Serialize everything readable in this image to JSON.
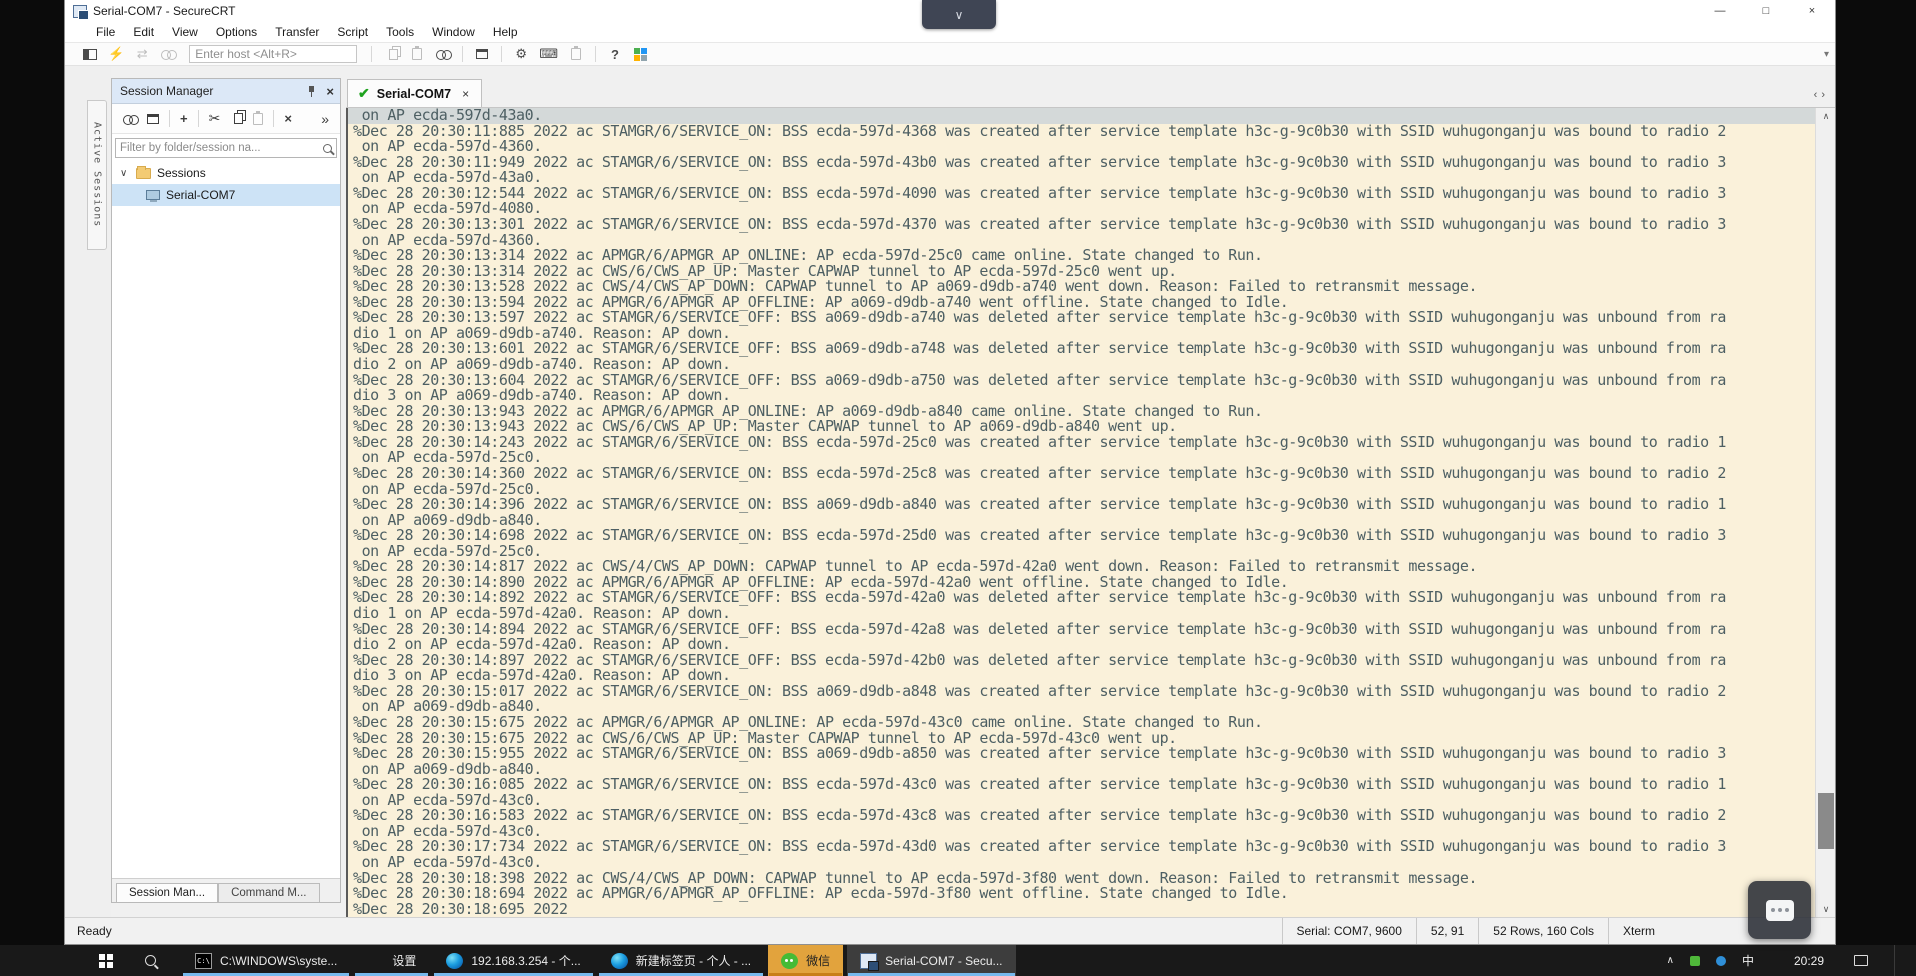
{
  "window": {
    "title": "Serial-COM7 - SecureCRT"
  },
  "icons": {
    "window_min": "—",
    "window_max": "□",
    "window_close": "×",
    "quick_connect": "⚡",
    "reconnect": "⇄",
    "help": "?",
    "gear": "⚙",
    "keypad": "⌨",
    "plus": "+",
    "scissors": "✂",
    "delete_x": "×",
    "overflow": "»",
    "tab_check": "✔",
    "tab_close": "×",
    "chev_down": "∨",
    "chev_up": "∧",
    "chev_left": "‹",
    "chev_right": "›",
    "toolbar_more": "▾",
    "tree_expander": "∨"
  },
  "menu": {
    "items": [
      "File",
      "Edit",
      "View",
      "Options",
      "Transfer",
      "Script",
      "Tools",
      "Window",
      "Help"
    ]
  },
  "toolbar": {
    "host_placeholder": "Enter host <Alt+R>"
  },
  "session_manager": {
    "title": "Session Manager",
    "side_tab": "Active Sessions",
    "filter_placeholder": "Filter by folder/session na...",
    "tree": {
      "root": "Sessions",
      "session": "Serial-COM7"
    },
    "bottom_tabs": [
      "Session Man...",
      "Command M..."
    ]
  },
  "tab": {
    "label": "Serial-COM7"
  },
  "terminal": {
    "selected_row": 0,
    "lines": [
      " on AP ecda-597d-43a0.",
      "%Dec 28 20:30:11:885 2022 ac STAMGR/6/SERVICE_ON: BSS ecda-597d-4368 was created after service template h3c-g-9c0b30 with SSID wuhugonganju was bound to radio 2",
      " on AP ecda-597d-4360.",
      "%Dec 28 20:30:11:949 2022 ac STAMGR/6/SERVICE_ON: BSS ecda-597d-43b0 was created after service template h3c-g-9c0b30 with SSID wuhugonganju was bound to radio 3",
      " on AP ecda-597d-43a0.",
      "%Dec 28 20:30:12:544 2022 ac STAMGR/6/SERVICE_ON: BSS ecda-597d-4090 was created after service template h3c-g-9c0b30 with SSID wuhugonganju was bound to radio 3",
      " on AP ecda-597d-4080.",
      "%Dec 28 20:30:13:301 2022 ac STAMGR/6/SERVICE_ON: BSS ecda-597d-4370 was created after service template h3c-g-9c0b30 with SSID wuhugonganju was bound to radio 3",
      " on AP ecda-597d-4360.",
      "%Dec 28 20:30:13:314 2022 ac APMGR/6/APMGR_AP_ONLINE: AP ecda-597d-25c0 came online. State changed to Run.",
      "%Dec 28 20:30:13:314 2022 ac CWS/6/CWS_AP_UP: Master CAPWAP tunnel to AP ecda-597d-25c0 went up.",
      "%Dec 28 20:30:13:528 2022 ac CWS/4/CWS_AP_DOWN: CAPWAP tunnel to AP a069-d9db-a740 went down. Reason: Failed to retransmit message.",
      "%Dec 28 20:30:13:594 2022 ac APMGR/6/APMGR_AP_OFFLINE: AP a069-d9db-a740 went offline. State changed to Idle.",
      "%Dec 28 20:30:13:597 2022 ac STAMGR/6/SERVICE_OFF: BSS a069-d9db-a740 was deleted after service template h3c-g-9c0b30 with SSID wuhugonganju was unbound from ra",
      "dio 1 on AP a069-d9db-a740. Reason: AP down.",
      "%Dec 28 20:30:13:601 2022 ac STAMGR/6/SERVICE_OFF: BSS a069-d9db-a748 was deleted after service template h3c-g-9c0b30 with SSID wuhugonganju was unbound from ra",
      "dio 2 on AP a069-d9db-a740. Reason: AP down.",
      "%Dec 28 20:30:13:604 2022 ac STAMGR/6/SERVICE_OFF: BSS a069-d9db-a750 was deleted after service template h3c-g-9c0b30 with SSID wuhugonganju was unbound from ra",
      "dio 3 on AP a069-d9db-a740. Reason: AP down.",
      "%Dec 28 20:30:13:943 2022 ac APMGR/6/APMGR_AP_ONLINE: AP a069-d9db-a840 came online. State changed to Run.",
      "%Dec 28 20:30:13:943 2022 ac CWS/6/CWS_AP_UP: Master CAPWAP tunnel to AP a069-d9db-a840 went up.",
      "%Dec 28 20:30:14:243 2022 ac STAMGR/6/SERVICE_ON: BSS ecda-597d-25c0 was created after service template h3c-g-9c0b30 with SSID wuhugonganju was bound to radio 1",
      " on AP ecda-597d-25c0.",
      "%Dec 28 20:30:14:360 2022 ac STAMGR/6/SERVICE_ON: BSS ecda-597d-25c8 was created after service template h3c-g-9c0b30 with SSID wuhugonganju was bound to radio 2",
      " on AP ecda-597d-25c0.",
      "%Dec 28 20:30:14:396 2022 ac STAMGR/6/SERVICE_ON: BSS a069-d9db-a840 was created after service template h3c-g-9c0b30 with SSID wuhugonganju was bound to radio 1",
      " on AP a069-d9db-a840.",
      "%Dec 28 20:30:14:698 2022 ac STAMGR/6/SERVICE_ON: BSS ecda-597d-25d0 was created after service template h3c-g-9c0b30 with SSID wuhugonganju was bound to radio 3",
      " on AP ecda-597d-25c0.",
      "%Dec 28 20:30:14:817 2022 ac CWS/4/CWS_AP_DOWN: CAPWAP tunnel to AP ecda-597d-42a0 went down. Reason: Failed to retransmit message.",
      "%Dec 28 20:30:14:890 2022 ac APMGR/6/APMGR_AP_OFFLINE: AP ecda-597d-42a0 went offline. State changed to Idle.",
      "%Dec 28 20:30:14:892 2022 ac STAMGR/6/SERVICE_OFF: BSS ecda-597d-42a0 was deleted after service template h3c-g-9c0b30 with SSID wuhugonganju was unbound from ra",
      "dio 1 on AP ecda-597d-42a0. Reason: AP down.",
      "%Dec 28 20:30:14:894 2022 ac STAMGR/6/SERVICE_OFF: BSS ecda-597d-42a8 was deleted after service template h3c-g-9c0b30 with SSID wuhugonganju was unbound from ra",
      "dio 2 on AP ecda-597d-42a0. Reason: AP down.",
      "%Dec 28 20:30:14:897 2022 ac STAMGR/6/SERVICE_OFF: BSS ecda-597d-42b0 was deleted after service template h3c-g-9c0b30 with SSID wuhugonganju was unbound from ra",
      "dio 3 on AP ecda-597d-42a0. Reason: AP down.",
      "%Dec 28 20:30:15:017 2022 ac STAMGR/6/SERVICE_ON: BSS a069-d9db-a848 was created after service template h3c-g-9c0b30 with SSID wuhugonganju was bound to radio 2",
      " on AP a069-d9db-a840.",
      "%Dec 28 20:30:15:675 2022 ac APMGR/6/APMGR_AP_ONLINE: AP ecda-597d-43c0 came online. State changed to Run.",
      "%Dec 28 20:30:15:675 2022 ac CWS/6/CWS_AP_UP: Master CAPWAP tunnel to AP ecda-597d-43c0 went up.",
      "%Dec 28 20:30:15:955 2022 ac STAMGR/6/SERVICE_ON: BSS a069-d9db-a850 was created after service template h3c-g-9c0b30 with SSID wuhugonganju was bound to radio 3",
      " on AP a069-d9db-a840.",
      "%Dec 28 20:30:16:085 2022 ac STAMGR/6/SERVICE_ON: BSS ecda-597d-43c0 was created after service template h3c-g-9c0b30 with SSID wuhugonganju was bound to radio 1",
      " on AP ecda-597d-43c0.",
      "%Dec 28 20:30:16:583 2022 ac STAMGR/6/SERVICE_ON: BSS ecda-597d-43c8 was created after service template h3c-g-9c0b30 with SSID wuhugonganju was bound to radio 2",
      " on AP ecda-597d-43c0.",
      "%Dec 28 20:30:17:734 2022 ac STAMGR/6/SERVICE_ON: BSS ecda-597d-43d0 was created after service template h3c-g-9c0b30 with SSID wuhugonganju was bound to radio 3",
      " on AP ecda-597d-43c0.",
      "%Dec 28 20:30:18:398 2022 ac CWS/4/CWS_AP_DOWN: CAPWAP tunnel to AP ecda-597d-3f80 went down. Reason: Failed to retransmit message.",
      "%Dec 28 20:30:18:694 2022 ac APMGR/6/APMGR_AP_OFFLINE: AP ecda-597d-3f80 went offline. State changed to Idle.",
      "%Dec 28 20:30:18:695 2022"
    ]
  },
  "status_bar": {
    "ready": "Ready",
    "cells": [
      "Serial: COM7, 9600",
      "52, 91",
      "52 Rows, 160 Cols",
      "Xterm"
    ]
  },
  "taskbar": {
    "items": [
      {
        "icon": "cmd",
        "icon_text": "C:\\",
        "label": "C:\\WINDOWS\\syste...",
        "active": false,
        "attention": false
      },
      {
        "icon": "gear",
        "label": "设置",
        "active": false,
        "attention": false
      },
      {
        "icon": "edge",
        "label": "192.168.3.254 - 个...",
        "active": false,
        "attention": false
      },
      {
        "icon": "edge",
        "label": "新建标签页 - 个人 - ...",
        "active": false,
        "attention": false
      },
      {
        "icon": "wechat",
        "label": "微信",
        "active": false,
        "attention": true
      },
      {
        "icon": "securecrt",
        "label": "Serial-COM7 - Secu...",
        "active": true,
        "attention": false
      }
    ],
    "tray": {
      "ime": "中",
      "time": "20:29"
    }
  },
  "colors": {
    "terminal_bg": "#faf1da",
    "terminal_fg": "#4d5f63",
    "selection_gray": "#d4d9d9",
    "tree_selection": "#cde3f6",
    "tab_check_green": "#1fa31f",
    "taskbar_bg": "#191919",
    "taskbar_underline": "#76b9ed",
    "attention_orange": "#e2a33d",
    "panel_header": "#dce8f7"
  }
}
